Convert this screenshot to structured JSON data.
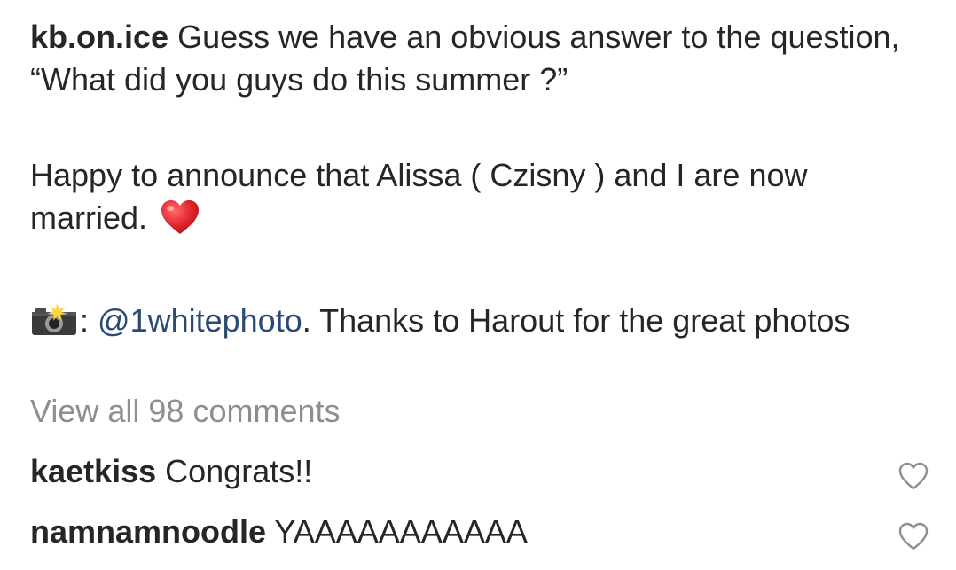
{
  "post": {
    "author": "kb.on.ice",
    "caption_line1": "Guess we have an obvious answer to the question, “What did you guys do this summer ?”",
    "caption_line2": "Happy to announce that Alissa ( Czisny ) and I are now married.",
    "heart_emoji": "red-heart-icon",
    "camera_emoji": "camera-with-flash-icon",
    "credit_separator": ":",
    "credit_mention": "@1whitephoto",
    "credit_text": ".  Thanks to Harout for the great photos"
  },
  "view_all_comments": "View all 98 comments",
  "comments": [
    {
      "username": "kaetkiss",
      "text": "Congrats!!",
      "like_icon": "heart-outline-icon"
    },
    {
      "username": "namnamnoodle",
      "text": "YAAAAAAAAAAA",
      "like_icon": "heart-outline-icon"
    }
  ],
  "colors": {
    "text": "#262626",
    "muted": "#8e8e8e",
    "mention": "#2b4a73",
    "heart_red": "#e0262d"
  }
}
